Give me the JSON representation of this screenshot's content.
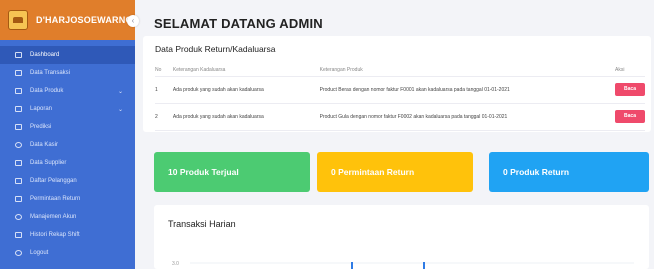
{
  "brand": {
    "name": "D'HARJOSOEWARNO",
    "toggle_icon": "chevron-left-icon"
  },
  "sidebar": {
    "items": [
      {
        "label": "Dashboard",
        "icon": "dashboard-icon",
        "active": true,
        "has_caret": false
      },
      {
        "label": "Data Transaksi",
        "icon": "transaction-icon",
        "active": false,
        "has_caret": false
      },
      {
        "label": "Data Produk",
        "icon": "product-icon",
        "active": false,
        "has_caret": true
      },
      {
        "label": "Laporan",
        "icon": "report-icon",
        "active": false,
        "has_caret": true
      },
      {
        "label": "Prediksi",
        "icon": "prediction-icon",
        "active": false,
        "has_caret": false
      },
      {
        "label": "Data Kasir",
        "icon": "cashier-icon",
        "active": false,
        "has_caret": false
      },
      {
        "label": "Data Supplier",
        "icon": "supplier-icon",
        "active": false,
        "has_caret": false
      },
      {
        "label": "Daftar Pelanggan",
        "icon": "customer-icon",
        "active": false,
        "has_caret": false
      },
      {
        "label": "Permintaan Return",
        "icon": "return-icon",
        "active": false,
        "has_caret": false
      },
      {
        "label": "Manajemen Akun",
        "icon": "account-icon",
        "active": false,
        "has_caret": false
      },
      {
        "label": "Histori Rekap Shift",
        "icon": "history-icon",
        "active": false,
        "has_caret": false
      },
      {
        "label": "Logout",
        "icon": "logout-icon",
        "active": false,
        "has_caret": false
      }
    ]
  },
  "header": {
    "title": "SELAMAT DATANG ADMIN"
  },
  "returns": {
    "title": "Data Produk Return/Kadaluarsa",
    "columns": [
      "No",
      "Keterangan Kadaluarsa",
      "Keterangan Produk",
      "Aksi"
    ],
    "rows": [
      {
        "no": "1",
        "ket": "Ada produk yang sudah akan kadaluarsa",
        "produk": "Product Beras dengan nomor faktur F0001 akan kadaluarsa pada tanggal 01-01-2021",
        "aksi": "Baca"
      },
      {
        "no": "2",
        "ket": "Ada produk yang sudah akan kadaluarsa",
        "produk": "Product Gula dengan nomor faktur F0002 akan kadaluarsa pada tanggal 01-01-2021",
        "aksi": "Baca"
      }
    ]
  },
  "stats": {
    "sold": "10 Produk Terjual",
    "returns": "0 Permintaan Return",
    "products": "0 Produk Return"
  },
  "colors": {
    "sidebar": "#3f6ed3",
    "brand": "#e07e2b",
    "green": "#4ccb72",
    "yellow": "#ffc20b",
    "blue": "#20a3f3",
    "danger": "#ef4a6b"
  },
  "chart_data": {
    "type": "line",
    "title": "Transaksi Harian",
    "tick_labels": [
      "3.0"
    ],
    "note": "chart is cropped; only top tick label and two spike tops visible"
  }
}
